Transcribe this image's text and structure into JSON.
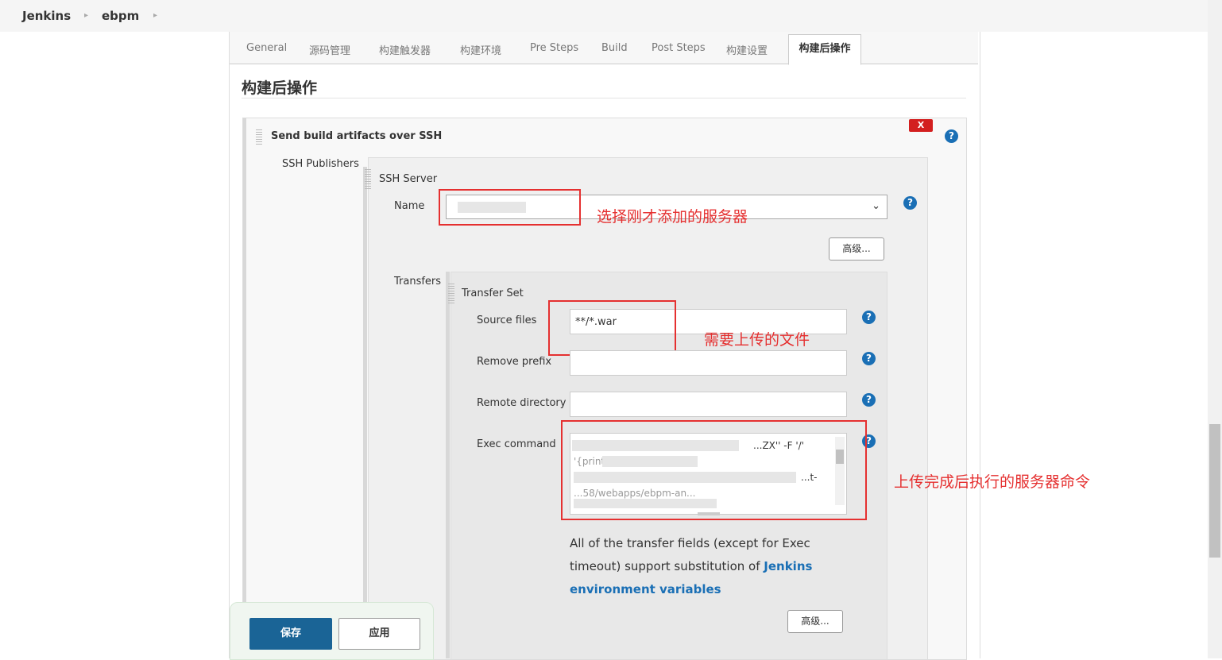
{
  "breadcrumb": {
    "items": [
      "Jenkins",
      "ebpm"
    ]
  },
  "tabs": [
    "General",
    "源码管理",
    "构建触发器",
    "构建环境",
    "Pre Steps",
    "Build",
    "Post Steps",
    "构建设置",
    "构建后操作"
  ],
  "section": {
    "title": "构建后操作"
  },
  "publisher": {
    "title": "Send build artifacts over SSH",
    "delete_label": "X",
    "ssh_publishers_label": "SSH Publishers",
    "ssh_server_label": "SSH Server",
    "name_label": "Name",
    "advanced_label": "高级...",
    "transfers_label": "Transfers",
    "transfer_set_label": "Transfer Set",
    "source_files_label": "Source files",
    "source_files_value": "**/*.war",
    "remove_prefix_label": "Remove prefix",
    "remove_prefix_value": "",
    "remote_directory_label": "Remote directory",
    "remote_directory_value": "",
    "exec_command_label": "Exec command",
    "exec_command_fragments": [
      "...ZX'' -F '/'",
      "'{print $...",
      "...t-",
      "...58/webapps/ebpm-an..."
    ],
    "note_text": "All of the transfer fields (except for Exec timeout) support substitution of ",
    "note_link": "Jenkins environment variables",
    "advanced2_label": "高级..."
  },
  "annotations": {
    "select_server": "选择刚才添加的服务器",
    "upload_files": "需要上传的文件",
    "exec_after_upload": "上传完成后执行的服务器命令"
  },
  "footer": {
    "save_label": "保存",
    "apply_label": "应用"
  },
  "help_glyph": "?",
  "colors": {
    "save_button": "#1a6496",
    "annotation_red": "#e53030",
    "help_blue": "#1a6fb5",
    "delete_red": "#d31f1f"
  }
}
